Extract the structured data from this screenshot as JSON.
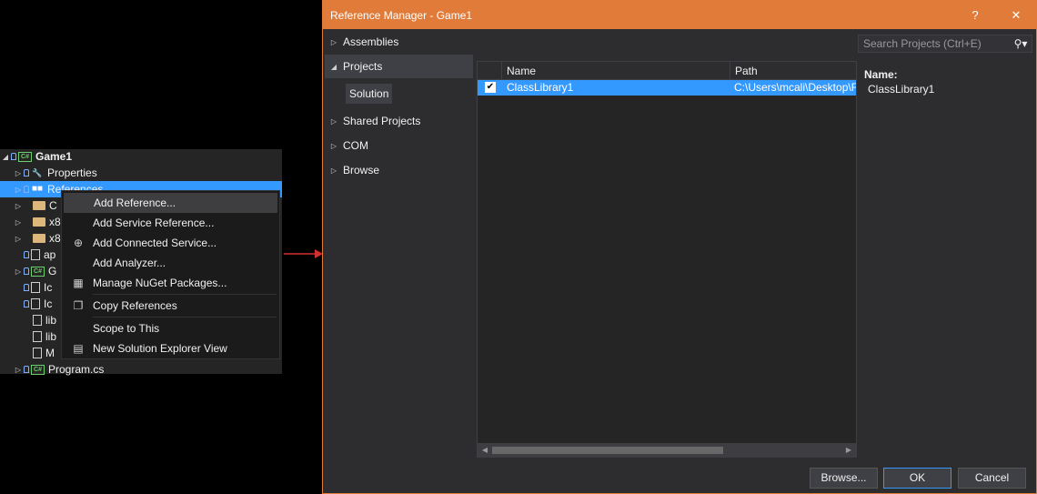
{
  "solution_explorer": {
    "project": "Game1",
    "items": [
      {
        "label": "Properties"
      },
      {
        "label": "References"
      },
      {
        "label": "C"
      },
      {
        "label": "x8"
      },
      {
        "label": "x8"
      },
      {
        "label": "ap"
      },
      {
        "label": "G"
      },
      {
        "label": "Ic"
      },
      {
        "label": "Ic"
      },
      {
        "label": "lib"
      },
      {
        "label": "lib"
      },
      {
        "label": "M"
      },
      {
        "label": "Program.cs"
      }
    ]
  },
  "context_menu": {
    "items": [
      {
        "label": "Add Reference...",
        "icon": "none",
        "highlighted": true
      },
      {
        "label": "Add Service Reference...",
        "icon": "none"
      },
      {
        "label": "Add Connected Service...",
        "icon": "connected-service-icon"
      },
      {
        "label": "Add Analyzer...",
        "icon": "none"
      },
      {
        "label": "Manage NuGet Packages...",
        "icon": "nuget-icon"
      },
      {
        "label": "Copy References",
        "icon": "copy-icon"
      },
      {
        "label": "Scope to This",
        "icon": "none"
      },
      {
        "label": "New Solution Explorer View",
        "icon": "new-view-icon"
      }
    ]
  },
  "dialog": {
    "title": "Reference Manager - Game1",
    "help": "?",
    "close": "✕",
    "nav": {
      "assemblies": "Assemblies",
      "projects": "Projects",
      "solution": "Solution",
      "shared_projects": "Shared Projects",
      "com": "COM",
      "browse": "Browse"
    },
    "search_placeholder": "Search Projects (Ctrl+E)",
    "columns": {
      "name": "Name",
      "path": "Path"
    },
    "rows": [
      {
        "checked": true,
        "name": "ClassLibrary1",
        "path": "C:\\Users\\mcali\\Desktop\\F"
      }
    ],
    "details": {
      "label": "Name:",
      "value": "ClassLibrary1"
    },
    "buttons": {
      "browse": "Browse...",
      "ok": "OK",
      "cancel": "Cancel"
    }
  },
  "colors": {
    "accent": "#e07b39",
    "selection": "#3399ff",
    "arrow": "#d32f2f"
  }
}
